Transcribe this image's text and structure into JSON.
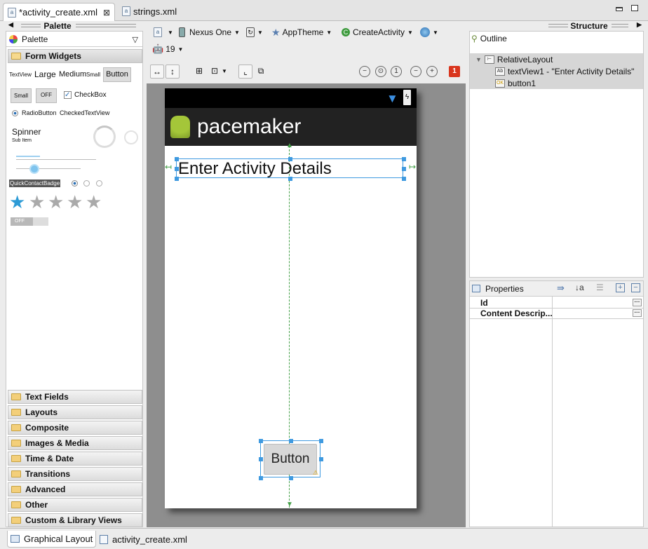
{
  "editor_tabs": [
    {
      "label": "*activity_create.xml"
    },
    {
      "label": "strings.xml"
    }
  ],
  "palette": {
    "title": "Palette",
    "dropdown_label": "Palette",
    "open_category": "Form Widgets",
    "widgets": {
      "textview": "TextView",
      "large": "Large",
      "medium": "Medium",
      "small": "Small",
      "button": "Button",
      "small_button": "Small",
      "toggle_off": "OFF",
      "checkbox": "CheckBox",
      "radiobutton": "RadioButton",
      "checkedtextview": "CheckedTextView",
      "spinner": "Spinner",
      "spinner_sub": "Sub Item",
      "quickcontactbadge": "QuickContactBadge",
      "switch_off": "OFF"
    },
    "categories": [
      "Text Fields",
      "Layouts",
      "Composite",
      "Images & Media",
      "Time & Date",
      "Transitions",
      "Advanced",
      "Other",
      "Custom & Library Views"
    ]
  },
  "toolbar": {
    "device": "Nexus One",
    "theme": "AppTheme",
    "activity": "CreateActivity",
    "api_level": "19",
    "error_count": "1"
  },
  "preview": {
    "app_title": "pacemaker",
    "text_view": "Enter Activity Details",
    "button": "Button"
  },
  "structure": {
    "title": "Structure",
    "outline_title": "Outline",
    "nodes": [
      {
        "label": "RelativeLayout"
      },
      {
        "label": "textView1 - \"Enter Activity Details\""
      },
      {
        "label": "button1"
      }
    ]
  },
  "properties": {
    "title": "Properties",
    "rows": [
      {
        "name": "Id"
      },
      {
        "name": "Content Descrip..."
      }
    ]
  },
  "bottom_tabs": [
    {
      "label": "Graphical Layout"
    },
    {
      "label": "activity_create.xml"
    }
  ],
  "colors": {
    "selection_blue": "#3f9ae0",
    "guide_green": "#45a049",
    "action_bar": "#222222",
    "error_red": "#d9351d"
  }
}
